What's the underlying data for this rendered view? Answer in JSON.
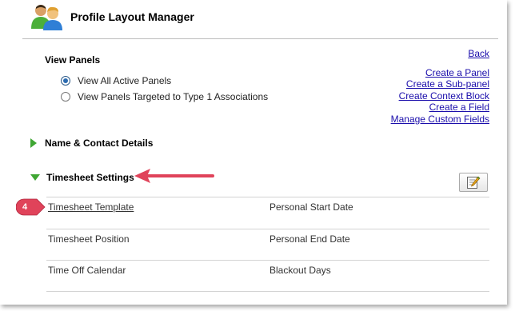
{
  "header": {
    "title": "Profile Layout Manager",
    "icon": "people-icon"
  },
  "view_panels": {
    "title": "View Panels",
    "options": [
      {
        "label": "View All Active Panels",
        "selected": true
      },
      {
        "label": "View Panels Targeted to Type 1 Associations",
        "selected": false
      }
    ]
  },
  "links": {
    "back": "Back",
    "create_panel": "Create a Panel",
    "create_subpanel": "Create a Sub-panel",
    "create_context_block": "Create Context Block",
    "create_field": "Create a Field",
    "manage_custom_fields": "Manage Custom Fields"
  },
  "sections": {
    "name_contact": {
      "label": "Name & Contact Details",
      "expanded": false
    },
    "timesheet": {
      "label": "Timesheet Settings",
      "expanded": true
    }
  },
  "callout": {
    "number": "4",
    "color": "#e0435a"
  },
  "fields": {
    "row1_left": "Timesheet Template",
    "row1_right": "Personal Start Date",
    "row2_left": "Timesheet Position",
    "row2_right": "Personal End Date",
    "row3_left": "Time Off Calendar",
    "row3_right": "Blackout Days"
  },
  "colors": {
    "link": "#1a0dab",
    "expand_triangle": "#3fa633",
    "annotation": "#e0435a"
  }
}
